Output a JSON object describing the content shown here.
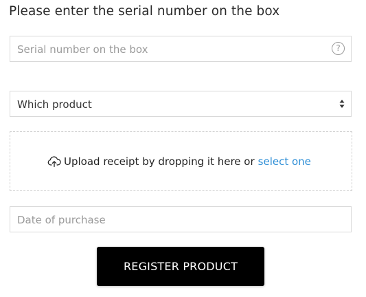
{
  "heading": "Please enter the serial number on the box",
  "serial": {
    "placeholder": "Serial number on the box",
    "value": "",
    "help_icon": "question-circle-icon",
    "help_glyph": "?"
  },
  "product": {
    "selected": "Which product",
    "arrow_icon": "select-arrows-icon"
  },
  "upload": {
    "icon": "cloud-upload-icon",
    "text": "Upload receipt by dropping it here or",
    "link": "select one",
    "link_color": "#2d8ed6"
  },
  "date": {
    "placeholder": "Date of purchase",
    "value": ""
  },
  "submit": {
    "label": "REGISTER PRODUCT",
    "background": "#000000",
    "text_color": "#ffffff"
  }
}
